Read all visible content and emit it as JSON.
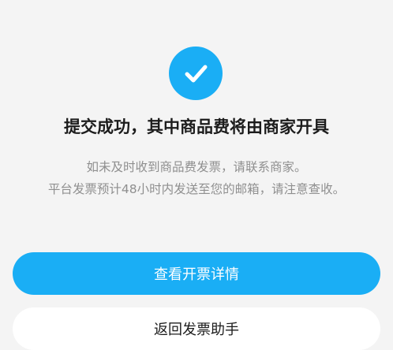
{
  "colors": {
    "accent": "#1aaef5",
    "background": "#f4f4f4"
  },
  "success": {
    "icon": "checkmark-circle-icon",
    "title": "提交成功，其中商品费将由商家开具",
    "desc_line1": "如未及时收到商品费发票，请联系商家。",
    "desc_line2": "平台发票预计48小时内发送至您的邮箱，请注意查收。"
  },
  "actions": {
    "view_invoice_label": "查看开票详情",
    "back_label": "返回发票助手"
  }
}
